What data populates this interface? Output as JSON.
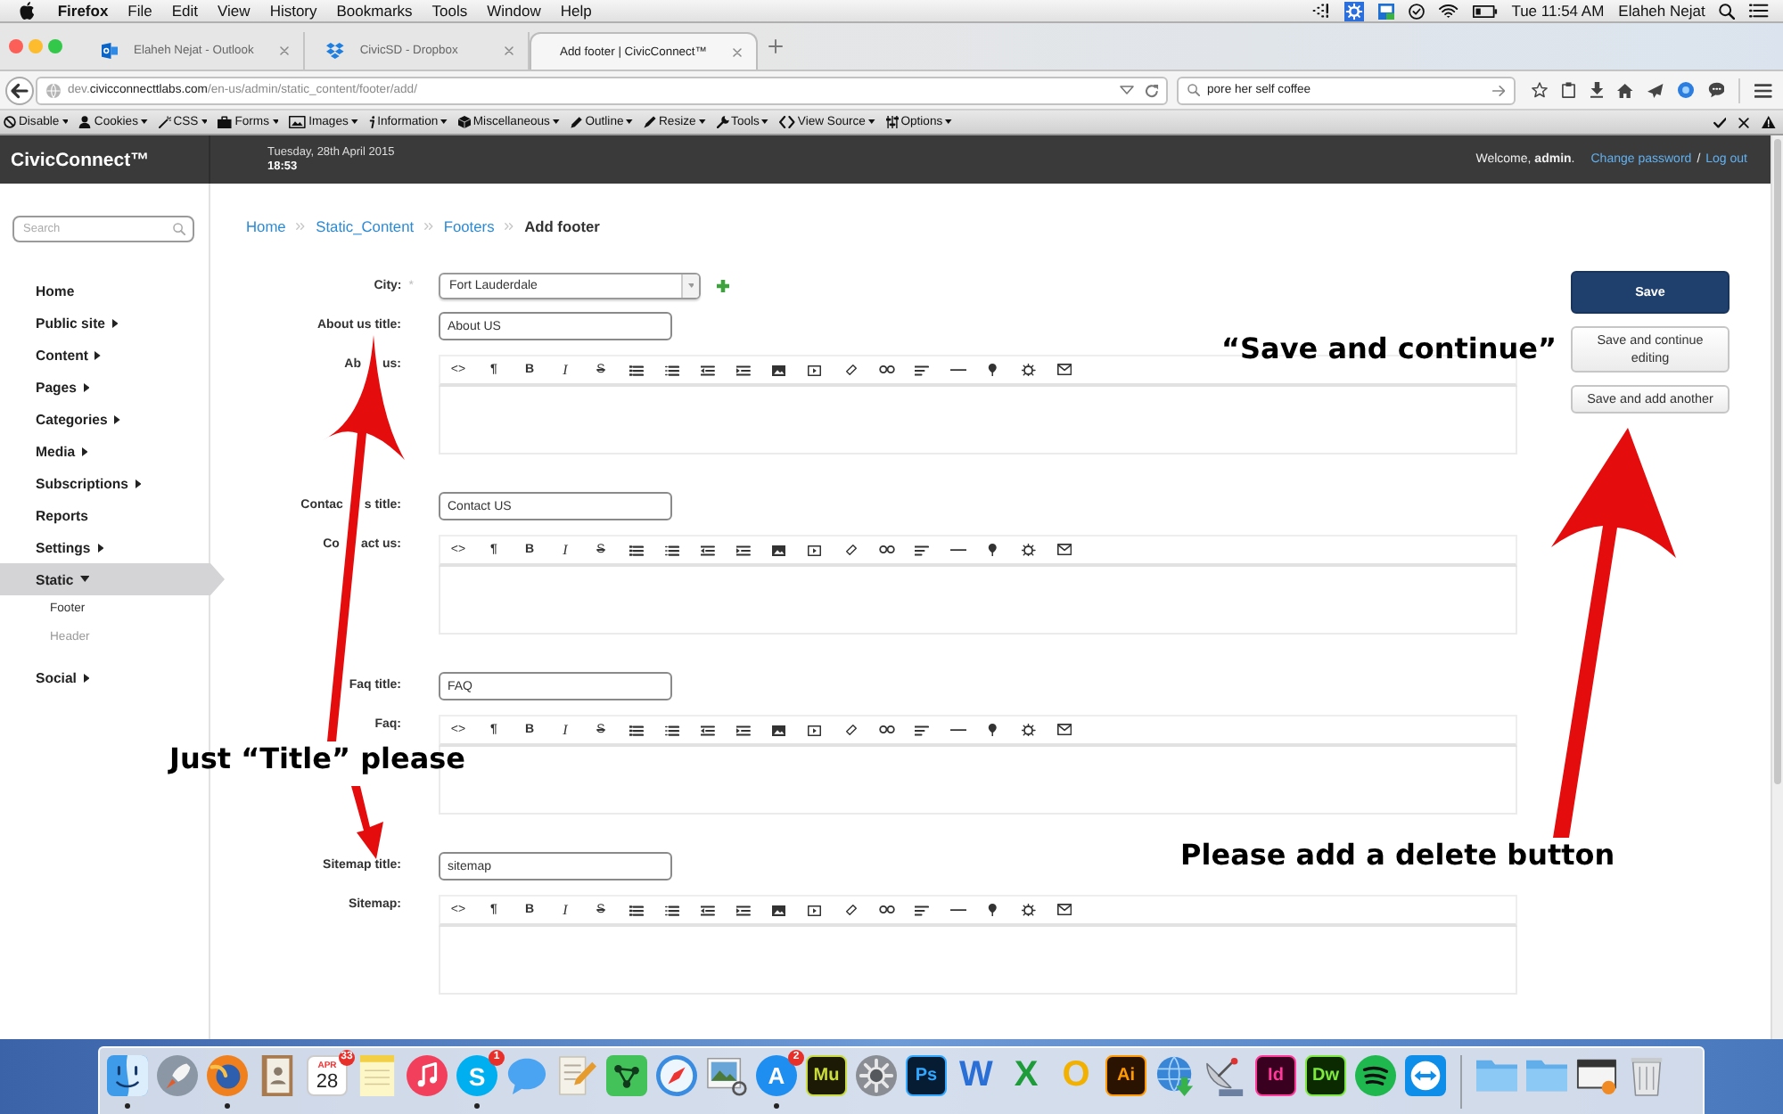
{
  "menubar": {
    "app": "Firefox",
    "menus": [
      "File",
      "Edit",
      "View",
      "History",
      "Bookmarks",
      "Tools",
      "Window",
      "Help"
    ],
    "clock": "Tue 11:54 AM",
    "user": "Elaheh Nejat"
  },
  "tabs": [
    {
      "title": "Elaheh Nejat - Outlook",
      "selected": false
    },
    {
      "title": "CivicSD - Dropbox",
      "selected": false
    },
    {
      "title": "Add footer | CivicConnect™",
      "selected": true
    }
  ],
  "address_bar": {
    "url": [
      {
        "text": "dev.",
        "highlighted": false
      },
      {
        "text": "civicconnecttlabs.com",
        "highlighted": true
      },
      {
        "text": "/en-us/admin/static_content/footer/add/",
        "highlighted": false
      }
    ],
    "search": "pore her self coffee"
  },
  "dev_toolbar": {
    "menus": [
      "Disable",
      "Cookies",
      "CSS",
      "Forms",
      "Images",
      "Information",
      "Miscellaneous",
      "Outline",
      "Resize",
      "Tools",
      "View Source",
      "Options"
    ]
  },
  "header": {
    "brand": "CivicConnect™",
    "date": "Tuesday, 28th April 2015",
    "time": "18:53",
    "welcome": "Welcome, **admin**.",
    "links": [
      "Change password",
      "Log out"
    ],
    "link_separator": "/"
  },
  "sidebar": {
    "search": {
      "placeholder": "Search"
    },
    "items": [
      {
        "label": "Home",
        "kind": "link",
        "selected": false
      },
      {
        "label": "Public site",
        "kind": "menu",
        "selected": false,
        "expanded": false
      },
      {
        "label": "Content",
        "kind": "menu",
        "selected": false,
        "expanded": false
      },
      {
        "label": "Pages",
        "kind": "menu",
        "selected": false,
        "expanded": false
      },
      {
        "label": "Categories",
        "kind": "menu",
        "selected": false,
        "expanded": false
      },
      {
        "label": "Media",
        "kind": "menu",
        "selected": false,
        "expanded": false
      },
      {
        "label": "Subscriptions",
        "kind": "menu",
        "selected": false,
        "expanded": false
      },
      {
        "label": "Reports",
        "kind": "link",
        "selected": false
      },
      {
        "label": "Settings",
        "kind": "menu",
        "selected": false,
        "expanded": false
      },
      {
        "label": "Static",
        "kind": "menu",
        "selected": true,
        "expanded": true,
        "children": [
          {
            "label": "Footer",
            "selected": true
          },
          {
            "label": "Header",
            "selected": false
          }
        ]
      },
      {
        "label": "Social",
        "kind": "menu",
        "selected": false,
        "expanded": false
      }
    ]
  },
  "breadcrumb": [
    {
      "label": "Home",
      "current": false
    },
    {
      "label": "Static_Content",
      "current": false
    },
    {
      "label": "Footers",
      "current": false
    },
    {
      "label": "Add footer",
      "current": true
    }
  ],
  "form": {
    "fields": [
      {
        "kind": "select",
        "label": "City:",
        "required_mark": "*",
        "value": "Fort Lauderdale"
      },
      {
        "kind": "text",
        "label": "About us title:",
        "value": "About US"
      },
      {
        "kind": "editor",
        "label": [
          "Ab",
          "us:"
        ],
        "toolbar": [
          "<>",
          "¶",
          "B",
          "I",
          "S"
        ]
      },
      {
        "kind": "text",
        "label": [
          "Contac",
          "s title:"
        ],
        "value": "Contact US"
      },
      {
        "kind": "editor",
        "label": [
          "Co",
          "act us:"
        ],
        "toolbar": [
          "<>",
          "¶",
          "B",
          "I",
          "S"
        ]
      },
      {
        "kind": "text",
        "label": "Faq title:",
        "value": "FAQ"
      },
      {
        "kind": "editor",
        "label": "Faq:",
        "toolbar": [
          "<>",
          "¶",
          "B",
          "I",
          "S"
        ]
      },
      {
        "kind": "text",
        "label": "Sitemap title:",
        "value": "sitemap"
      },
      {
        "kind": "editor",
        "label": "Sitemap:",
        "toolbar": [
          "<>",
          "¶",
          "B",
          "I",
          "S"
        ]
      }
    ]
  },
  "actions": [
    {
      "label": "Save",
      "primary": true
    },
    {
      "label": "Save and continue editing",
      "primary": false
    },
    {
      "label": "Save and add another",
      "primary": false
    }
  ],
  "annotations": [
    "“Save and continue”",
    "Just “Title” please",
    "Please add a delete button"
  ],
  "dock": {
    "apps": [
      {
        "kind": "face",
        "running": true
      },
      {
        "kind": "rocket",
        "running": false
      },
      {
        "kind": "fox",
        "running": true
      },
      {
        "kind": "book",
        "running": false
      },
      {
        "kind": "calendar",
        "month": "APR",
        "day": "28",
        "badge": "33",
        "running": false
      },
      {
        "kind": "notepad",
        "running": false
      },
      {
        "kind": "music",
        "running": false
      },
      {
        "kind": "skype",
        "glyph": "S",
        "badge": "1",
        "running": true
      },
      {
        "kind": "bubble",
        "running": false
      },
      {
        "kind": "pencil",
        "running": false
      },
      {
        "kind": "network",
        "running": false
      },
      {
        "kind": "compass",
        "running": false
      },
      {
        "kind": "preview",
        "running": false
      },
      {
        "kind": "store",
        "glyph": "A",
        "badge": "2",
        "running": true
      },
      {
        "kind": "muse",
        "glyph": "Mu",
        "running": false
      },
      {
        "kind": "gear",
        "running": false
      },
      {
        "kind": "photoshop",
        "glyph": "Ps",
        "running": false
      },
      {
        "kind": "word",
        "glyph": "W",
        "running": false
      },
      {
        "kind": "excel",
        "glyph": "X",
        "running": false
      },
      {
        "kind": "outlook",
        "glyph": "O",
        "running": false
      },
      {
        "kind": "illustrator",
        "glyph": "Ai",
        "running": false
      },
      {
        "kind": "globe",
        "running": false
      },
      {
        "kind": "dish",
        "running": false
      },
      {
        "kind": "indesign",
        "glyph": "Id",
        "running": false
      },
      {
        "kind": "dreamweaver",
        "glyph": "Dw",
        "running": false
      },
      {
        "kind": "spotify",
        "running": false
      },
      {
        "kind": "teamviewer",
        "running": false
      }
    ],
    "stacks": [
      {
        "kind": "folder"
      },
      {
        "kind": "folder"
      },
      {
        "kind": "window"
      },
      {
        "kind": "trash"
      }
    ]
  }
}
